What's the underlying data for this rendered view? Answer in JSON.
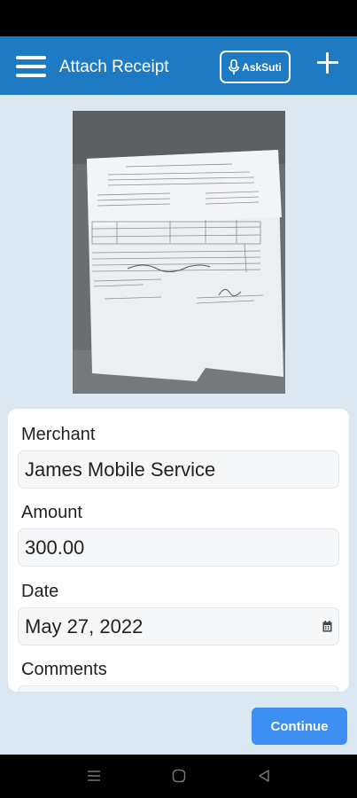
{
  "app_bar": {
    "title": "Attach Receipt",
    "ask_label": "AskSuti",
    "icons": [
      "menu-icon",
      "microphone-icon",
      "plus-icon"
    ]
  },
  "receipt": {
    "image_subject": "photo of a paper receipt"
  },
  "form": {
    "merchant_label": "Merchant",
    "merchant_value": "James Mobile Service",
    "amount_label": "Amount",
    "amount_value": "300.00",
    "date_label": "Date",
    "date_value": "May 27, 2022",
    "comments_label": "Comments",
    "comments_value": ""
  },
  "actions": {
    "continue_label": "Continue"
  },
  "nav": {
    "icons": [
      "recents-icon",
      "home-icon",
      "back-icon"
    ]
  },
  "colors": {
    "app_bar": "#1f7ac4",
    "background": "#dbe7f1",
    "continue_button": "#3d8ff2"
  }
}
